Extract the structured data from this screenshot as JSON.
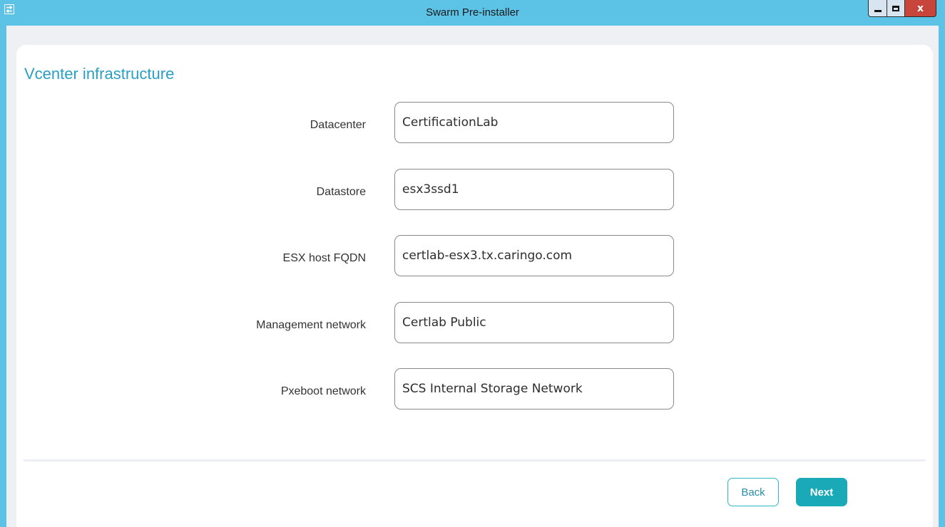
{
  "window": {
    "title": "Swarm Pre-installer",
    "icon": "swap-arrows-icon",
    "controls": {
      "minimize": "minimize-icon",
      "maximize": "maximize-icon",
      "close": "x"
    }
  },
  "page": {
    "title": "Vcenter infrastructure"
  },
  "form": {
    "fields": [
      {
        "label": "Datacenter",
        "value": "CertificationLab"
      },
      {
        "label": "Datastore",
        "value": "esx3ssd1"
      },
      {
        "label": "ESX host FQDN",
        "value": "certlab-esx3.tx.caringo.com"
      },
      {
        "label": "Management network",
        "value": "Certlab Public"
      },
      {
        "label": "Pxeboot network",
        "value": "SCS Internal Storage Network"
      }
    ]
  },
  "buttons": {
    "back": "Back",
    "next": "Next"
  },
  "colors": {
    "titlebar": "#5cc3e6",
    "accent": "#1aa9b7",
    "title_text": "#2a9fc5",
    "close_button": "#c7453a"
  }
}
